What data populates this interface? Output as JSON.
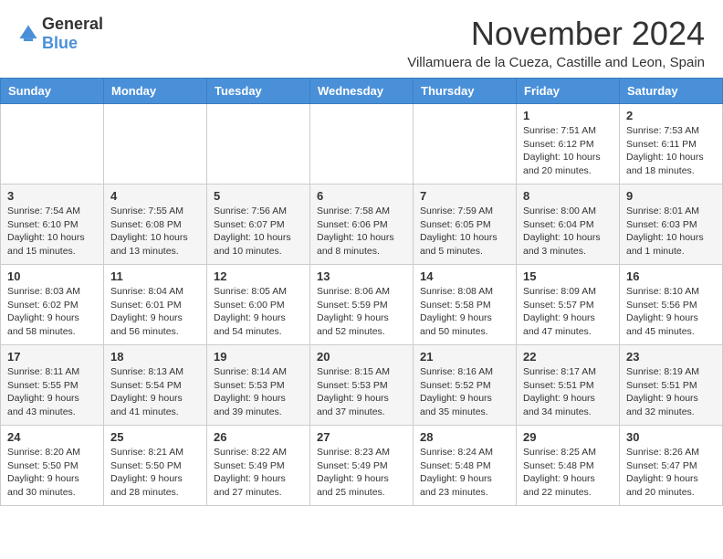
{
  "header": {
    "logo_general": "General",
    "logo_blue": "Blue",
    "month_title": "November 2024",
    "location": "Villamuera de la Cueza, Castille and Leon, Spain"
  },
  "weekdays": [
    "Sunday",
    "Monday",
    "Tuesday",
    "Wednesday",
    "Thursday",
    "Friday",
    "Saturday"
  ],
  "weeks": [
    [
      {
        "day": "",
        "sunrise": "",
        "sunset": "",
        "daylight": ""
      },
      {
        "day": "",
        "sunrise": "",
        "sunset": "",
        "daylight": ""
      },
      {
        "day": "",
        "sunrise": "",
        "sunset": "",
        "daylight": ""
      },
      {
        "day": "",
        "sunrise": "",
        "sunset": "",
        "daylight": ""
      },
      {
        "day": "",
        "sunrise": "",
        "sunset": "",
        "daylight": ""
      },
      {
        "day": "1",
        "sunrise": "Sunrise: 7:51 AM",
        "sunset": "Sunset: 6:12 PM",
        "daylight": "Daylight: 10 hours and 20 minutes."
      },
      {
        "day": "2",
        "sunrise": "Sunrise: 7:53 AM",
        "sunset": "Sunset: 6:11 PM",
        "daylight": "Daylight: 10 hours and 18 minutes."
      }
    ],
    [
      {
        "day": "3",
        "sunrise": "Sunrise: 7:54 AM",
        "sunset": "Sunset: 6:10 PM",
        "daylight": "Daylight: 10 hours and 15 minutes."
      },
      {
        "day": "4",
        "sunrise": "Sunrise: 7:55 AM",
        "sunset": "Sunset: 6:08 PM",
        "daylight": "Daylight: 10 hours and 13 minutes."
      },
      {
        "day": "5",
        "sunrise": "Sunrise: 7:56 AM",
        "sunset": "Sunset: 6:07 PM",
        "daylight": "Daylight: 10 hours and 10 minutes."
      },
      {
        "day": "6",
        "sunrise": "Sunrise: 7:58 AM",
        "sunset": "Sunset: 6:06 PM",
        "daylight": "Daylight: 10 hours and 8 minutes."
      },
      {
        "day": "7",
        "sunrise": "Sunrise: 7:59 AM",
        "sunset": "Sunset: 6:05 PM",
        "daylight": "Daylight: 10 hours and 5 minutes."
      },
      {
        "day": "8",
        "sunrise": "Sunrise: 8:00 AM",
        "sunset": "Sunset: 6:04 PM",
        "daylight": "Daylight: 10 hours and 3 minutes."
      },
      {
        "day": "9",
        "sunrise": "Sunrise: 8:01 AM",
        "sunset": "Sunset: 6:03 PM",
        "daylight": "Daylight: 10 hours and 1 minute."
      }
    ],
    [
      {
        "day": "10",
        "sunrise": "Sunrise: 8:03 AM",
        "sunset": "Sunset: 6:02 PM",
        "daylight": "Daylight: 9 hours and 58 minutes."
      },
      {
        "day": "11",
        "sunrise": "Sunrise: 8:04 AM",
        "sunset": "Sunset: 6:01 PM",
        "daylight": "Daylight: 9 hours and 56 minutes."
      },
      {
        "day": "12",
        "sunrise": "Sunrise: 8:05 AM",
        "sunset": "Sunset: 6:00 PM",
        "daylight": "Daylight: 9 hours and 54 minutes."
      },
      {
        "day": "13",
        "sunrise": "Sunrise: 8:06 AM",
        "sunset": "Sunset: 5:59 PM",
        "daylight": "Daylight: 9 hours and 52 minutes."
      },
      {
        "day": "14",
        "sunrise": "Sunrise: 8:08 AM",
        "sunset": "Sunset: 5:58 PM",
        "daylight": "Daylight: 9 hours and 50 minutes."
      },
      {
        "day": "15",
        "sunrise": "Sunrise: 8:09 AM",
        "sunset": "Sunset: 5:57 PM",
        "daylight": "Daylight: 9 hours and 47 minutes."
      },
      {
        "day": "16",
        "sunrise": "Sunrise: 8:10 AM",
        "sunset": "Sunset: 5:56 PM",
        "daylight": "Daylight: 9 hours and 45 minutes."
      }
    ],
    [
      {
        "day": "17",
        "sunrise": "Sunrise: 8:11 AM",
        "sunset": "Sunset: 5:55 PM",
        "daylight": "Daylight: 9 hours and 43 minutes."
      },
      {
        "day": "18",
        "sunrise": "Sunrise: 8:13 AM",
        "sunset": "Sunset: 5:54 PM",
        "daylight": "Daylight: 9 hours and 41 minutes."
      },
      {
        "day": "19",
        "sunrise": "Sunrise: 8:14 AM",
        "sunset": "Sunset: 5:53 PM",
        "daylight": "Daylight: 9 hours and 39 minutes."
      },
      {
        "day": "20",
        "sunrise": "Sunrise: 8:15 AM",
        "sunset": "Sunset: 5:53 PM",
        "daylight": "Daylight: 9 hours and 37 minutes."
      },
      {
        "day": "21",
        "sunrise": "Sunrise: 8:16 AM",
        "sunset": "Sunset: 5:52 PM",
        "daylight": "Daylight: 9 hours and 35 minutes."
      },
      {
        "day": "22",
        "sunrise": "Sunrise: 8:17 AM",
        "sunset": "Sunset: 5:51 PM",
        "daylight": "Daylight: 9 hours and 34 minutes."
      },
      {
        "day": "23",
        "sunrise": "Sunrise: 8:19 AM",
        "sunset": "Sunset: 5:51 PM",
        "daylight": "Daylight: 9 hours and 32 minutes."
      }
    ],
    [
      {
        "day": "24",
        "sunrise": "Sunrise: 8:20 AM",
        "sunset": "Sunset: 5:50 PM",
        "daylight": "Daylight: 9 hours and 30 minutes."
      },
      {
        "day": "25",
        "sunrise": "Sunrise: 8:21 AM",
        "sunset": "Sunset: 5:50 PM",
        "daylight": "Daylight: 9 hours and 28 minutes."
      },
      {
        "day": "26",
        "sunrise": "Sunrise: 8:22 AM",
        "sunset": "Sunset: 5:49 PM",
        "daylight": "Daylight: 9 hours and 27 minutes."
      },
      {
        "day": "27",
        "sunrise": "Sunrise: 8:23 AM",
        "sunset": "Sunset: 5:49 PM",
        "daylight": "Daylight: 9 hours and 25 minutes."
      },
      {
        "day": "28",
        "sunrise": "Sunrise: 8:24 AM",
        "sunset": "Sunset: 5:48 PM",
        "daylight": "Daylight: 9 hours and 23 minutes."
      },
      {
        "day": "29",
        "sunrise": "Sunrise: 8:25 AM",
        "sunset": "Sunset: 5:48 PM",
        "daylight": "Daylight: 9 hours and 22 minutes."
      },
      {
        "day": "30",
        "sunrise": "Sunrise: 8:26 AM",
        "sunset": "Sunset: 5:47 PM",
        "daylight": "Daylight: 9 hours and 20 minutes."
      }
    ]
  ]
}
